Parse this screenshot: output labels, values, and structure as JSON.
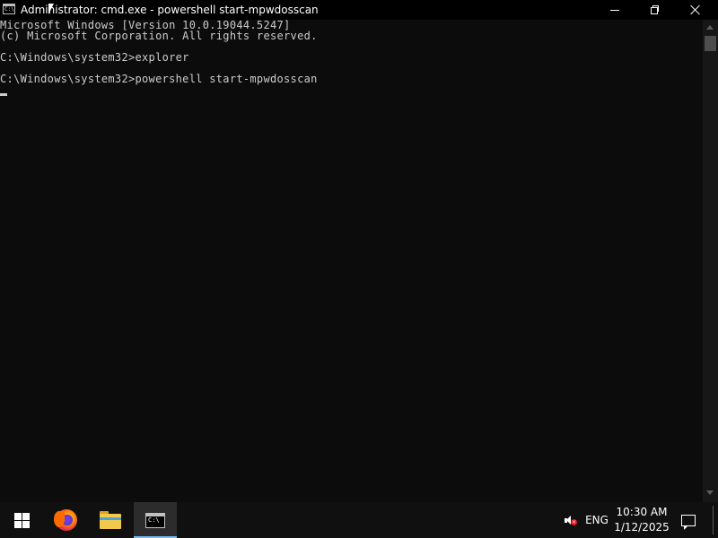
{
  "window": {
    "title": "Administrator: cmd.exe - powershell  start-mpwdosscan",
    "icon": "cmd-icon",
    "icon_text": "C:\\",
    "controls": {
      "minimize": "minimize-icon",
      "maximize": "restore-icon",
      "close": "close-icon"
    }
  },
  "console": {
    "lines": [
      "Microsoft Windows [Version 10.0.19044.5247]",
      "(c) Microsoft Corporation. All rights reserved.",
      "",
      "C:\\Windows\\system32>explorer",
      "",
      "C:\\Windows\\system32>powershell start-mpwdosscan"
    ],
    "text_color": "#cccccc",
    "background": "#0c0c0c"
  },
  "taskbar": {
    "items": [
      {
        "name": "start",
        "icon": "windows-logo-icon"
      },
      {
        "name": "firefox",
        "icon": "firefox-icon"
      },
      {
        "name": "file-explorer",
        "icon": "folder-icon"
      },
      {
        "name": "command-prompt",
        "icon": "cmd-icon",
        "active": true
      }
    ],
    "tray": {
      "volume_icon": "speaker-muted-icon",
      "language": "ENG",
      "time": "10:30 AM",
      "date": "1/12/2025",
      "notification_icon": "notification-icon"
    },
    "accent_color": "#76b9ed"
  }
}
